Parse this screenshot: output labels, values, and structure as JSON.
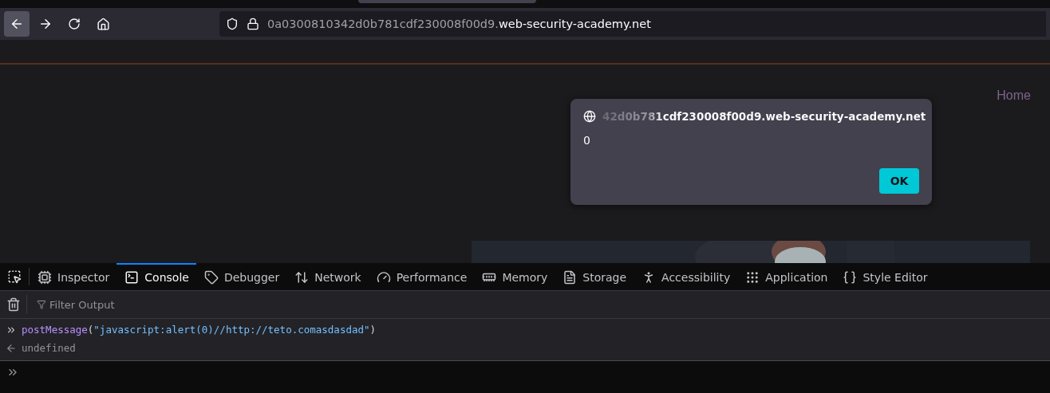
{
  "browser": {
    "url_prefix": "0a0300810342d0b781cdf230008f00d9.",
    "url_domain": "web-security-academy.net"
  },
  "page": {
    "nav_link": "Home"
  },
  "alert": {
    "origin": "42d0b781cdf230008f00d9.web-security-academy.net",
    "message": "0",
    "button": "OK"
  },
  "devtools": {
    "tabs": [
      {
        "label": "Inspector",
        "selected": false
      },
      {
        "label": "Console",
        "selected": true
      },
      {
        "label": "Debugger",
        "selected": false
      },
      {
        "label": "Network",
        "selected": false
      },
      {
        "label": "Performance",
        "selected": false
      },
      {
        "label": "Memory",
        "selected": false
      },
      {
        "label": "Storage",
        "selected": false
      },
      {
        "label": "Accessibility",
        "selected": false
      },
      {
        "label": "Application",
        "selected": false
      },
      {
        "label": "Style Editor",
        "selected": false
      }
    ],
    "filter_placeholder": "Filter Output",
    "input_tokens": [
      {
        "kind": "function",
        "text": "postMessage"
      },
      {
        "kind": "punct",
        "text": "("
      },
      {
        "kind": "string",
        "text": "\"javascript:alert(0)//http://teto.comasdasdad\""
      },
      {
        "kind": "punct",
        "text": ")"
      }
    ],
    "result": "undefined"
  }
}
